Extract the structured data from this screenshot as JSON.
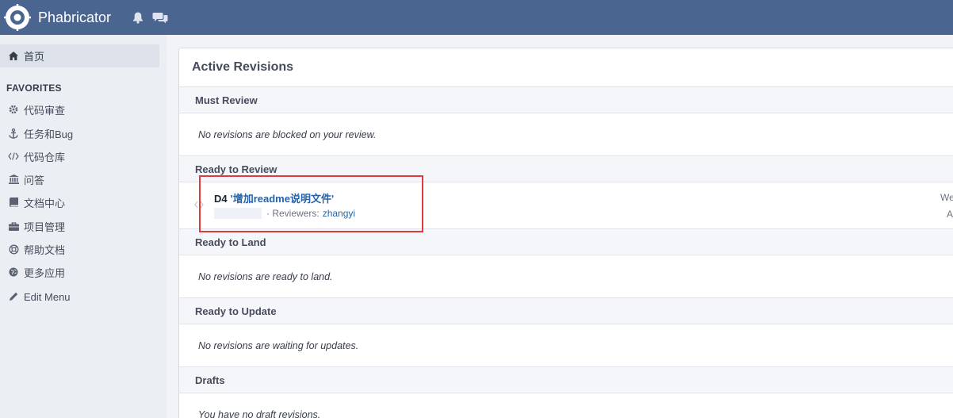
{
  "header": {
    "app_name": "Phabricator",
    "icons": [
      "eye-logo-icon",
      "bell-icon",
      "chat-icon"
    ],
    "bg_color": "#4b6591"
  },
  "sidebar": {
    "home": {
      "label": "首页",
      "icon": "home-icon"
    },
    "favorites_heading": "FAVORITES",
    "items": [
      {
        "label": "代码审查",
        "icon": "gear-icon"
      },
      {
        "label": "任务和Bug",
        "icon": "anchor-icon"
      },
      {
        "label": "代码仓库",
        "icon": "code-icon"
      },
      {
        "label": "问答",
        "icon": "bank-icon"
      },
      {
        "label": "文档中心",
        "icon": "book-icon"
      },
      {
        "label": "项目管理",
        "icon": "briefcase-icon"
      },
      {
        "label": "帮助文档",
        "icon": "lifebuoy-icon"
      },
      {
        "label": "更多应用",
        "icon": "globe-icon"
      },
      {
        "label": "Edit Menu",
        "icon": "pencil-icon"
      }
    ]
  },
  "main": {
    "title": "Active Revisions",
    "sections": {
      "must_review": {
        "heading": "Must Review",
        "empty_text": "No revisions are blocked on your review."
      },
      "ready_to_review": {
        "heading": "Ready to Review",
        "revision": {
          "id": "D4",
          "title": "'增加readme说明文件'",
          "reviewers_label": "· Reviewers:",
          "reviewer": "zhangyi",
          "right_top": "We",
          "right_bottom": "A"
        }
      },
      "ready_to_land": {
        "heading": "Ready to Land",
        "empty_text": "No revisions are ready to land."
      },
      "ready_to_update": {
        "heading": "Ready to Update",
        "empty_text": "No revisions are waiting for updates."
      },
      "drafts": {
        "heading": "Drafts",
        "empty_text": "You have no draft revisions."
      }
    },
    "highlight_color": "#e03b3b"
  }
}
